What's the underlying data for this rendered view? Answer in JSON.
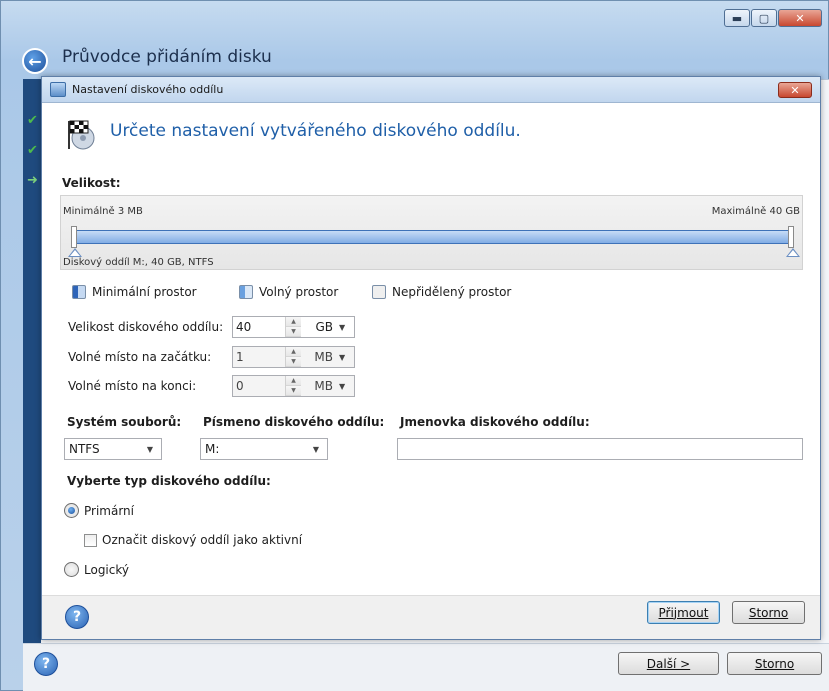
{
  "outer_window": {
    "title": "Průvodce přidáním disku",
    "buttons": {
      "minimize": "▬",
      "maximize": "▢",
      "close": "✕"
    },
    "footer": {
      "next_label": "Další >",
      "cancel_label": "Storno"
    }
  },
  "dialog": {
    "title": "Nastavení diskového oddílu",
    "close_symbol": "✕",
    "heading": "Určete nastavení vytvářeného diskového oddílu.",
    "size_section": {
      "label": "Velikost:",
      "min_label": "Minimálně 3 MB",
      "max_label": "Maximálně 40 GB",
      "partition_caption": "Diskový oddíl M:, 40 GB, NTFS",
      "fill_fraction": 1.0
    },
    "legend": {
      "min_space": "Minimální prostor",
      "free_space": "Volný prostor",
      "unallocated": "Nepřidělený prostor"
    },
    "fields": {
      "partition_size": {
        "label": "Velikost diskového oddílu:",
        "value": "40",
        "unit": "GB"
      },
      "free_before": {
        "label": "Volné místo na začátku:",
        "value": "1",
        "unit": "MB"
      },
      "free_after": {
        "label": "Volné místo na konci:",
        "value": "0",
        "unit": "MB"
      }
    },
    "file_system": {
      "label": "Systém souborů:",
      "value": "NTFS"
    },
    "drive_letter": {
      "label": "Písmeno diskového oddílu:",
      "value": "M:"
    },
    "volume_label": {
      "label": "Jmenovka diskového oddílu:",
      "value": ""
    },
    "partition_type": {
      "label": "Vyberte typ diskového oddílu:",
      "primary": "Primární",
      "mark_active": "Označit diskový oddíl jako aktivní",
      "logical": "Logický",
      "selected": "primary",
      "mark_active_checked": false
    },
    "footer": {
      "accept_label": "Přijmout",
      "cancel_label": "Storno"
    }
  },
  "colors": {
    "accent": "#1f5fa8",
    "slider_fill": "#82ade5",
    "title_bar": "#c1d6ee"
  }
}
